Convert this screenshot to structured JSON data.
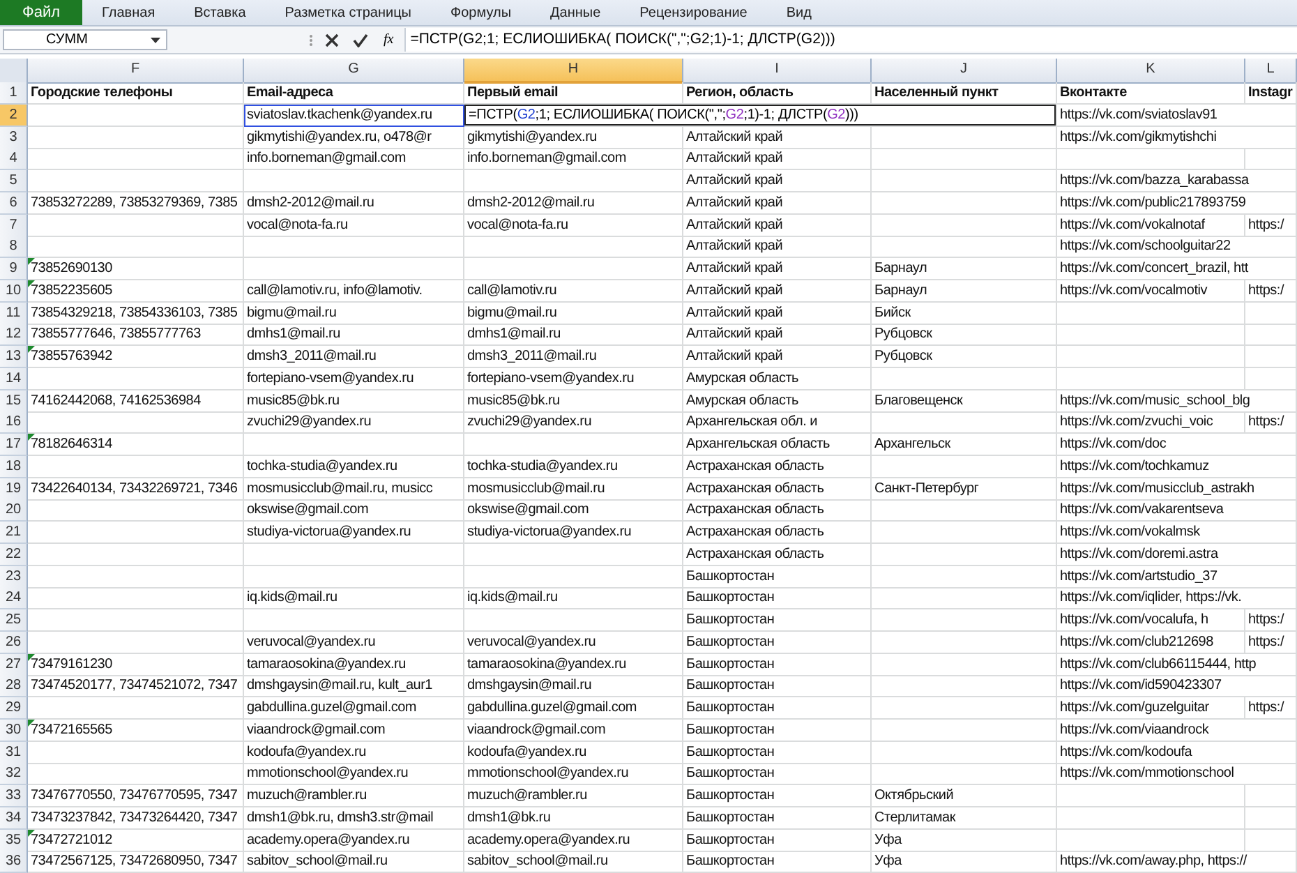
{
  "ribbon_tabs": [
    {
      "label": "Файл",
      "kind": "file"
    },
    {
      "label": "Главная",
      "kind": "tab"
    },
    {
      "label": "Вставка",
      "kind": "tab"
    },
    {
      "label": "Разметка страницы",
      "kind": "tab"
    },
    {
      "label": "Формулы",
      "kind": "tab"
    },
    {
      "label": "Данные",
      "kind": "tab"
    },
    {
      "label": "Рецензирование",
      "kind": "tab"
    },
    {
      "label": "Вид",
      "kind": "tab"
    }
  ],
  "formula_bar": {
    "name_box": "СУММ",
    "fx": "fx",
    "formula": "=ПСТР(G2;1; ЕСЛИОШИБКА( ПОИСК(\",\";G2;1)-1; ДЛСТР(G2)))"
  },
  "columns": [
    {
      "label": "F",
      "selected": false
    },
    {
      "label": "G",
      "selected": false
    },
    {
      "label": "H",
      "selected": true
    },
    {
      "label": "I",
      "selected": false
    },
    {
      "label": "J",
      "selected": false
    },
    {
      "label": "K",
      "selected": false
    },
    {
      "label": "L",
      "selected": false
    }
  ],
  "rows": [
    {
      "n": "1",
      "kind": "header",
      "selected": false,
      "warning": false,
      "cells": {
        "F": "Городские телефоны",
        "G": "Email-адреса",
        "H": "Первый email",
        "I": "Регион, область",
        "J": "Населенный пункт",
        "K": "Вконтакте",
        "L": "Instagr"
      }
    },
    {
      "n": "2",
      "kind": "data",
      "selected": true,
      "warning": false,
      "cells": {
        "G": "sviatoslav.tkachenk@yandex.ru",
        "H": {
          "kind": "editor",
          "tokens": [
            {
              "text": "=ПСТР(",
              "color": "#000000"
            },
            {
              "text": "G2",
              "color": "#2040d0"
            },
            {
              "text": ";1; ЕСЛИОШИБКА( ПОИСК(",
              "color": "#000000"
            },
            {
              "text": "\",\";",
              "color": "#000000"
            },
            {
              "text": "G2",
              "color": "#9030c0"
            },
            {
              "text": ";1)-1; ДЛСТР(",
              "color": "#000000"
            },
            {
              "text": "G2",
              "color": "#9030c0"
            },
            {
              "text": ")))",
              "color": "#000000"
            }
          ]
        },
        "K": "https://vk.com/sviatoslav91"
      }
    },
    {
      "n": "3",
      "kind": "data",
      "selected": false,
      "warning": false,
      "cells": {
        "G": "gikmytishi@yandex.ru, o478@r",
        "H": "gikmytishi@yandex.ru",
        "I": "Алтайский край",
        "K": "https://vk.com/gikmytishchi"
      }
    },
    {
      "n": "4",
      "kind": "data",
      "selected": false,
      "warning": false,
      "cells": {
        "G": "info.borneman@gmail.com",
        "H": "info.borneman@gmail.com",
        "I": "Алтайский край"
      }
    },
    {
      "n": "5",
      "kind": "data",
      "selected": false,
      "warning": false,
      "cells": {
        "I": "Алтайский край",
        "K": "https://vk.com/bazza_karabassa"
      }
    },
    {
      "n": "6",
      "kind": "data",
      "selected": false,
      "warning": false,
      "cells": {
        "F": "73853272289, 73853279369, 7385",
        "G": "dmsh2-2012@mail.ru",
        "H": "dmsh2-2012@mail.ru",
        "I": "Алтайский край",
        "K": "https://vk.com/public217893759"
      }
    },
    {
      "n": "7",
      "kind": "data",
      "selected": false,
      "warning": false,
      "cells": {
        "G": "vocal@nota-fa.ru",
        "H": "vocal@nota-fa.ru",
        "I": "Алтайский край",
        "K": "https://vk.com/vokalnotaf",
        "L": "https:/"
      }
    },
    {
      "n": "8",
      "kind": "data",
      "selected": false,
      "warning": false,
      "cells": {
        "I": "Алтайский край",
        "K": "https://vk.com/schoolguitar22"
      }
    },
    {
      "n": "9",
      "kind": "data",
      "selected": false,
      "warning": true,
      "cells": {
        "F": "73852690130",
        "I": "Алтайский край",
        "J": "Барнаул",
        "K": "https://vk.com/concert_brazil, htt"
      }
    },
    {
      "n": "10",
      "kind": "data",
      "selected": false,
      "warning": true,
      "cells": {
        "F": "73852235605",
        "G": "call@lamotiv.ru, info@lamotiv.",
        "H": "call@lamotiv.ru",
        "I": "Алтайский край",
        "J": "Барнаул",
        "K": "https://vk.com/vocalmotiv",
        "L": "https:/"
      }
    },
    {
      "n": "11",
      "kind": "data",
      "selected": false,
      "warning": false,
      "cells": {
        "F": "73854329218, 73854336103, 7385",
        "G": "bigmu@mail.ru",
        "H": "bigmu@mail.ru",
        "I": "Алтайский край",
        "J": "Бийск"
      }
    },
    {
      "n": "12",
      "kind": "data",
      "selected": false,
      "warning": false,
      "cells": {
        "F": "73855777646, 73855777763",
        "G": "dmhs1@mail.ru",
        "H": "dmhs1@mail.ru",
        "I": "Алтайский край",
        "J": "Рубцовск"
      }
    },
    {
      "n": "13",
      "kind": "data",
      "selected": false,
      "warning": true,
      "cells": {
        "F": "73855763942",
        "G": "dmsh3_2011@mail.ru",
        "H": "dmsh3_2011@mail.ru",
        "I": "Алтайский край",
        "J": "Рубцовск"
      }
    },
    {
      "n": "14",
      "kind": "data",
      "selected": false,
      "warning": false,
      "cells": {
        "G": "fortepiano-vsem@yandex.ru",
        "H": "fortepiano-vsem@yandex.ru",
        "I": "Амурская область"
      }
    },
    {
      "n": "15",
      "kind": "data",
      "selected": false,
      "warning": false,
      "cells": {
        "F": "74162442068, 74162536984",
        "G": "music85@bk.ru",
        "H": "music85@bk.ru",
        "I": "Амурская область",
        "J": "Благовещенск",
        "K": "https://vk.com/music_school_blg"
      }
    },
    {
      "n": "16",
      "kind": "data",
      "selected": false,
      "warning": false,
      "cells": {
        "G": "zvuchi29@yandex.ru",
        "H": "zvuchi29@yandex.ru",
        "I": "Архангельская обл. и",
        "K": "https://vk.com/zvuchi_voic",
        "L": "https:/"
      }
    },
    {
      "n": "17",
      "kind": "data",
      "selected": false,
      "warning": true,
      "cells": {
        "F": "78182646314",
        "I": "Архангельская область",
        "J": "Архангельск",
        "K": "https://vk.com/doc"
      }
    },
    {
      "n": "18",
      "kind": "data",
      "selected": false,
      "warning": false,
      "cells": {
        "G": "tochka-studia@yandex.ru",
        "H": "tochka-studia@yandex.ru",
        "I": "Астраханская область",
        "K": "https://vk.com/tochkamuz"
      }
    },
    {
      "n": "19",
      "kind": "data",
      "selected": false,
      "warning": false,
      "cells": {
        "F": "73422640134, 73432269721, 7346",
        "G": "mosmusicclub@mail.ru, musicc",
        "H": "mosmusicclub@mail.ru",
        "I": "Астраханская область",
        "J": "Санкт-Петербург",
        "K": "https://vk.com/musicclub_astrakh"
      }
    },
    {
      "n": "20",
      "kind": "data",
      "selected": false,
      "warning": false,
      "cells": {
        "G": "okswise@gmail.com",
        "H": "okswise@gmail.com",
        "I": "Астраханская область",
        "K": "https://vk.com/vakarentseva"
      }
    },
    {
      "n": "21",
      "kind": "data",
      "selected": false,
      "warning": false,
      "cells": {
        "G": "studiya-victorua@yandex.ru",
        "H": "studiya-victorua@yandex.ru",
        "I": "Астраханская область",
        "K": "https://vk.com/vokalmsk"
      }
    },
    {
      "n": "22",
      "kind": "data",
      "selected": false,
      "warning": false,
      "cells": {
        "I": "Астраханская область",
        "K": "https://vk.com/doremi.astra"
      }
    },
    {
      "n": "23",
      "kind": "data",
      "selected": false,
      "warning": false,
      "cells": {
        "I": "Башкортостан",
        "K": "https://vk.com/artstudio_37"
      }
    },
    {
      "n": "24",
      "kind": "data",
      "selected": false,
      "warning": false,
      "cells": {
        "G": "iq.kids@mail.ru",
        "H": "iq.kids@mail.ru",
        "I": "Башкортостан",
        "K": "https://vk.com/iqlider, https://vk."
      }
    },
    {
      "n": "25",
      "kind": "data",
      "selected": false,
      "warning": false,
      "cells": {
        "I": "Башкортостан",
        "K": "https://vk.com/vocalufa, h",
        "L": "https:/"
      }
    },
    {
      "n": "26",
      "kind": "data",
      "selected": false,
      "warning": false,
      "cells": {
        "G": "veruvocal@yandex.ru",
        "H": "veruvocal@yandex.ru",
        "I": "Башкортостан",
        "K": "https://vk.com/club212698",
        "L": "https:/"
      }
    },
    {
      "n": "27",
      "kind": "data",
      "selected": false,
      "warning": true,
      "cells": {
        "F": "73479161230",
        "G": "tamaraosokina@yandex.ru",
        "H": "tamaraosokina@yandex.ru",
        "I": "Башкортостан",
        "K": "https://vk.com/club66115444, http"
      }
    },
    {
      "n": "28",
      "kind": "data",
      "selected": false,
      "warning": false,
      "cells": {
        "F": "73474520177, 73474521072, 7347",
        "G": "dmshgaysin@mail.ru, kult_aur1",
        "H": "dmshgaysin@mail.ru",
        "I": "Башкортостан",
        "K": "https://vk.com/id590423307"
      }
    },
    {
      "n": "29",
      "kind": "data",
      "selected": false,
      "warning": false,
      "cells": {
        "G": "gabdullina.guzel@gmail.com",
        "H": "gabdullina.guzel@gmail.com",
        "I": "Башкортостан",
        "K": "https://vk.com/guzelguitar",
        "L": "https:/"
      }
    },
    {
      "n": "30",
      "kind": "data",
      "selected": false,
      "warning": true,
      "cells": {
        "F": "73472165565",
        "G": "viaandrock@gmail.com",
        "H": "viaandrock@gmail.com",
        "I": "Башкортостан",
        "K": "https://vk.com/viaandrock"
      }
    },
    {
      "n": "31",
      "kind": "data",
      "selected": false,
      "warning": false,
      "cells": {
        "G": "kodoufa@yandex.ru",
        "H": "kodoufa@yandex.ru",
        "I": "Башкортостан",
        "K": "https://vk.com/kodoufa"
      }
    },
    {
      "n": "32",
      "kind": "data",
      "selected": false,
      "warning": false,
      "cells": {
        "G": "mmotionschool@yandex.ru",
        "H": "mmotionschool@yandex.ru",
        "I": "Башкортостан",
        "K": "https://vk.com/mmotionschool"
      }
    },
    {
      "n": "33",
      "kind": "data",
      "selected": false,
      "warning": false,
      "cells": {
        "F": "73476770550, 73476770595, 7347",
        "G": "muzuch@rambler.ru",
        "H": "muzuch@rambler.ru",
        "I": "Башкортостан",
        "J": "Октябрьский"
      }
    },
    {
      "n": "34",
      "kind": "data",
      "selected": false,
      "warning": false,
      "cells": {
        "F": "73473237842, 73473264420, 7347",
        "G": "dmsh1@bk.ru, dmsh3.str@mail",
        "H": "dmsh1@bk.ru",
        "I": "Башкортостан",
        "J": "Стерлитамак"
      }
    },
    {
      "n": "35",
      "kind": "data",
      "selected": false,
      "warning": true,
      "cells": {
        "F": "73472721012",
        "G": "academy.opera@yandex.ru",
        "H": "academy.opera@yandex.ru",
        "I": "Башкортостан",
        "J": "Уфа"
      }
    },
    {
      "n": "36",
      "kind": "data",
      "selected": false,
      "warning": false,
      "cells": {
        "F": "73472567125, 73472680950, 7347",
        "G": "sabitov_school@mail.ru",
        "H": "sabitov_school@mail.ru",
        "I": "Башкортостан",
        "J": "Уфа",
        "K": "https://vk.com/away.php, https://"
      }
    }
  ]
}
